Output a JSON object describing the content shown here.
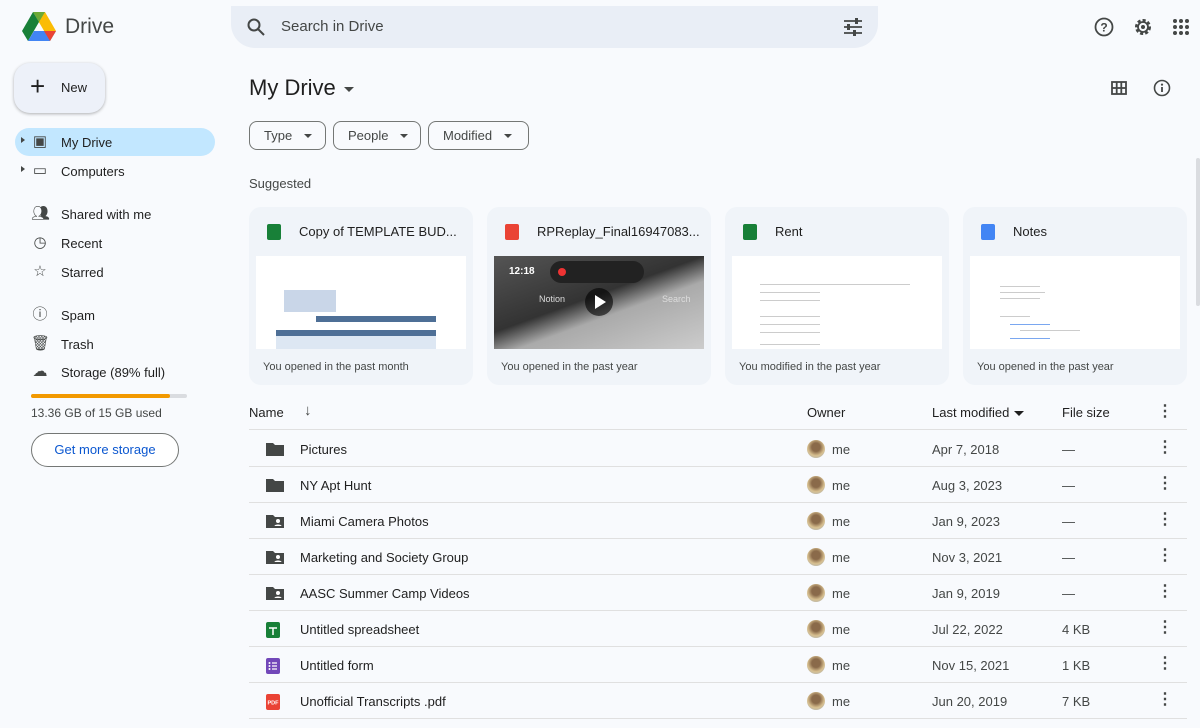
{
  "header": {
    "app_name": "Drive",
    "search_placeholder": "Search in Drive"
  },
  "sidebar": {
    "new_label": "New",
    "items": [
      {
        "label": "My Drive",
        "icon": "my-drive-icon",
        "active": true
      },
      {
        "label": "Computers",
        "icon": "computers-icon"
      },
      {
        "label": "Shared with me",
        "icon": "shared-icon"
      },
      {
        "label": "Recent",
        "icon": "clock-icon"
      },
      {
        "label": "Starred",
        "icon": "star-icon"
      },
      {
        "label": "Spam",
        "icon": "spam-icon"
      },
      {
        "label": "Trash",
        "icon": "trash-icon"
      },
      {
        "label": "Storage (89% full)",
        "icon": "cloud-icon"
      }
    ],
    "storage": {
      "used_text": "13.36 GB of 15 GB used",
      "percent": 89,
      "bar_color": "#f29900"
    },
    "get_more": "Get more storage"
  },
  "main": {
    "title": "My Drive",
    "filters": [
      "Type",
      "People",
      "Modified"
    ],
    "suggested_label": "Suggested",
    "cards": [
      {
        "title": "Copy of TEMPLATE BUD...",
        "type": "sheet",
        "footer": "You opened in the past month"
      },
      {
        "title": "RPReplay_Final16947083...",
        "type": "video",
        "footer": "You opened in the past year",
        "thumb": {
          "time": "12:18",
          "app": "Notion",
          "search": "Search"
        }
      },
      {
        "title": "Rent",
        "type": "sheet",
        "footer": "You modified in the past year"
      },
      {
        "title": "Notes",
        "type": "doc",
        "footer": "You opened in the past year"
      }
    ],
    "columns": {
      "name": "Name",
      "owner": "Owner",
      "modified": "Last modified",
      "size": "File size"
    },
    "rows": [
      {
        "name": "Pictures",
        "type": "folder",
        "owner": "me",
        "modified": "Apr 7, 2018",
        "size": "—"
      },
      {
        "name": "NY Apt Hunt",
        "type": "folder",
        "owner": "me",
        "modified": "Aug 3, 2023",
        "size": "—"
      },
      {
        "name": "Miami Camera Photos",
        "type": "shared-folder",
        "owner": "me",
        "modified": "Jan 9, 2023",
        "size": "—"
      },
      {
        "name": "Marketing and Society Group",
        "type": "shared-folder",
        "owner": "me",
        "modified": "Nov 3, 2021",
        "size": "—"
      },
      {
        "name": "AASC Summer Camp Videos",
        "type": "shared-folder",
        "owner": "me",
        "modified": "Jan 9, 2019",
        "size": "—"
      },
      {
        "name": "Untitled spreadsheet",
        "type": "sheet",
        "owner": "me",
        "modified": "Jul 22, 2022",
        "size": "4 KB"
      },
      {
        "name": "Untitled form",
        "type": "form",
        "owner": "me",
        "modified": "Nov 15, 2021",
        "size": "1 KB"
      },
      {
        "name": "Unofficial Transcripts .pdf",
        "type": "pdf",
        "owner": "me",
        "modified": "Jun 20, 2019",
        "size": "7 KB"
      }
    ]
  },
  "colors": {
    "accent": "#0b57d0",
    "active_nav": "#c2e7ff",
    "sheet": "#188038",
    "doc": "#4285f4",
    "video": "#ea4335",
    "form": "#7248b9",
    "pdf": "#ea4335"
  }
}
